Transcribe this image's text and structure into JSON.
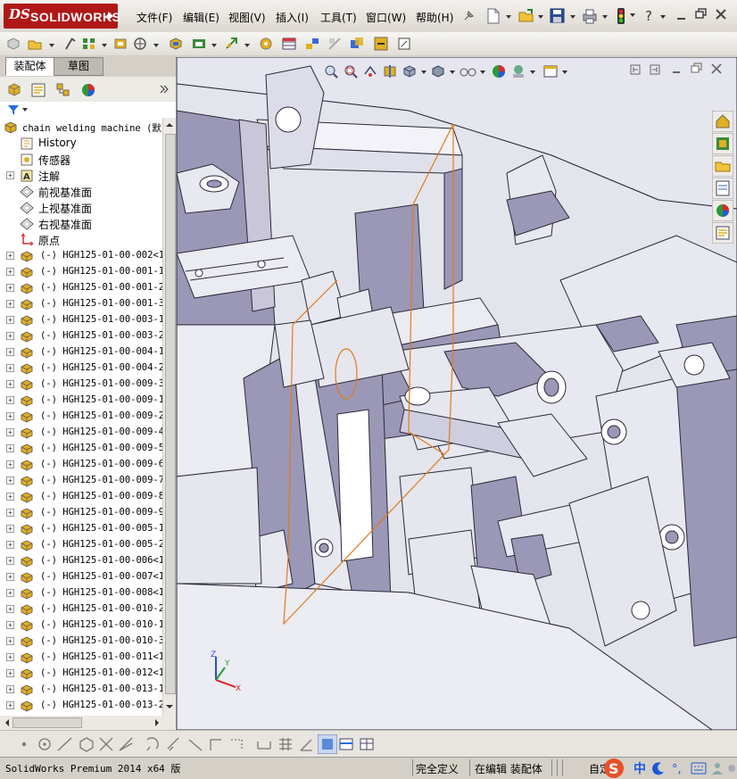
{
  "app": {
    "logo_prefix": "DS",
    "logo_text": "SOLIDWORKS"
  },
  "menu": [
    "文件(F)",
    "编辑(E)",
    "视图(V)",
    "插入(I)",
    "工具(T)",
    "窗口(W)",
    "帮助(H)"
  ],
  "left_tabs": [
    "装配体",
    "草图"
  ],
  "tree": {
    "root": "chain welding machine (默",
    "fixed_items": [
      {
        "label": "History",
        "icon": "history-icon"
      },
      {
        "label": "传感器",
        "icon": "sensor-icon"
      },
      {
        "label": "注解",
        "icon": "annotation-icon"
      },
      {
        "label": "前视基准面",
        "icon": "plane-icon"
      },
      {
        "label": "上视基准面",
        "icon": "plane-icon"
      },
      {
        "label": "右视基准面",
        "icon": "plane-icon"
      },
      {
        "label": "原点",
        "icon": "origin-icon"
      }
    ],
    "parts": [
      "(-) HGH125-01-00-002<1>",
      "(-) HGH125-01-00-001-1<",
      "(-) HGH125-01-00-001-2<",
      "(-) HGH125-01-00-001-3<",
      "(-) HGH125-01-00-003-1<",
      "(-) HGH125-01-00-003-2<",
      "(-) HGH125-01-00-004-1<",
      "(-) HGH125-01-00-004-2<",
      "(-) HGH125-01-00-009-3<",
      "(-) HGH125-01-00-009-1<",
      "(-) HGH125-01-00-009-2<",
      "(-) HGH125-01-00-009-4<",
      "(-) HGH125-01-00-009-5<",
      "(-) HGH125-01-00-009-6<",
      "(-) HGH125-01-00-009-7<",
      "(-) HGH125-01-00-009-8<",
      "(-) HGH125-01-00-009-9<",
      "(-) HGH125-01-00-005-1<",
      "(-) HGH125-01-00-005-2<",
      "(-) HGH125-01-00-006<1>",
      "(-) HGH125-01-00-007<1>",
      "(-) HGH125-01-00-008<1>",
      "(-) HGH125-01-00-010-2<",
      "(-) HGH125-01-00-010-1<",
      "(-) HGH125-01-00-010-3<",
      "(-) HGH125-01-00-011<1>",
      "(-) HGH125-01-00-012<1>",
      "(-) HGH125-01-00-013-1<",
      "(-) HGH125-01-00-013-2<"
    ]
  },
  "status": {
    "version": "SolidWorks Premium 2014 x64 版",
    "defined": "完全定义",
    "editing": "在编辑 装配体",
    "custom": "自定",
    "ime": "中"
  },
  "colors": {
    "brand_red": "#b01818",
    "part_face": "#9b97b6",
    "part_light": "#e8e8f0",
    "edge": "#2a2a3a",
    "selection": "#e07a1a"
  }
}
